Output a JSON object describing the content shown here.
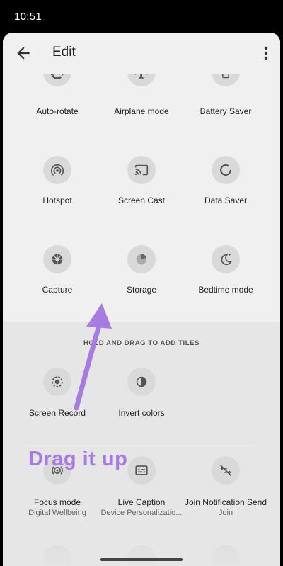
{
  "status": {
    "time": "10:51"
  },
  "header": {
    "title": "Edit"
  },
  "active_tiles": [
    {
      "label": "Auto-rotate",
      "icon": "auto-rotate-icon"
    },
    {
      "label": "Airplane mode",
      "icon": "airplane-icon"
    },
    {
      "label": "Battery Saver",
      "icon": "battery-saver-icon"
    },
    {
      "label": "Hotspot",
      "icon": "hotspot-icon"
    },
    {
      "label": "Screen Cast",
      "icon": "cast-icon"
    },
    {
      "label": "Data Saver",
      "icon": "data-saver-icon"
    },
    {
      "label": "Capture",
      "icon": "camera-shutter-icon"
    },
    {
      "label": "Storage",
      "icon": "storage-icon"
    },
    {
      "label": "Bedtime mode",
      "icon": "moon-stars-icon"
    }
  ],
  "add_section": {
    "hint": "HOLD AND DRAG TO ADD TILES",
    "tiles": [
      {
        "label": "Screen Record",
        "icon": "screen-record-icon"
      },
      {
        "label": "Invert colors",
        "icon": "invert-colors-icon"
      }
    ],
    "more_tiles": [
      {
        "label": "Focus mode",
        "sub": "Digital Wellbeing",
        "icon": "focus-mode-icon"
      },
      {
        "label": "Live Caption",
        "sub": "Device Personalizatio...",
        "icon": "live-caption-icon"
      },
      {
        "label": "Join Notification Send",
        "sub": "Join",
        "icon": "notification-off-icon"
      }
    ]
  },
  "annotation": {
    "text": "Drag it up",
    "color": "#a77be0"
  }
}
